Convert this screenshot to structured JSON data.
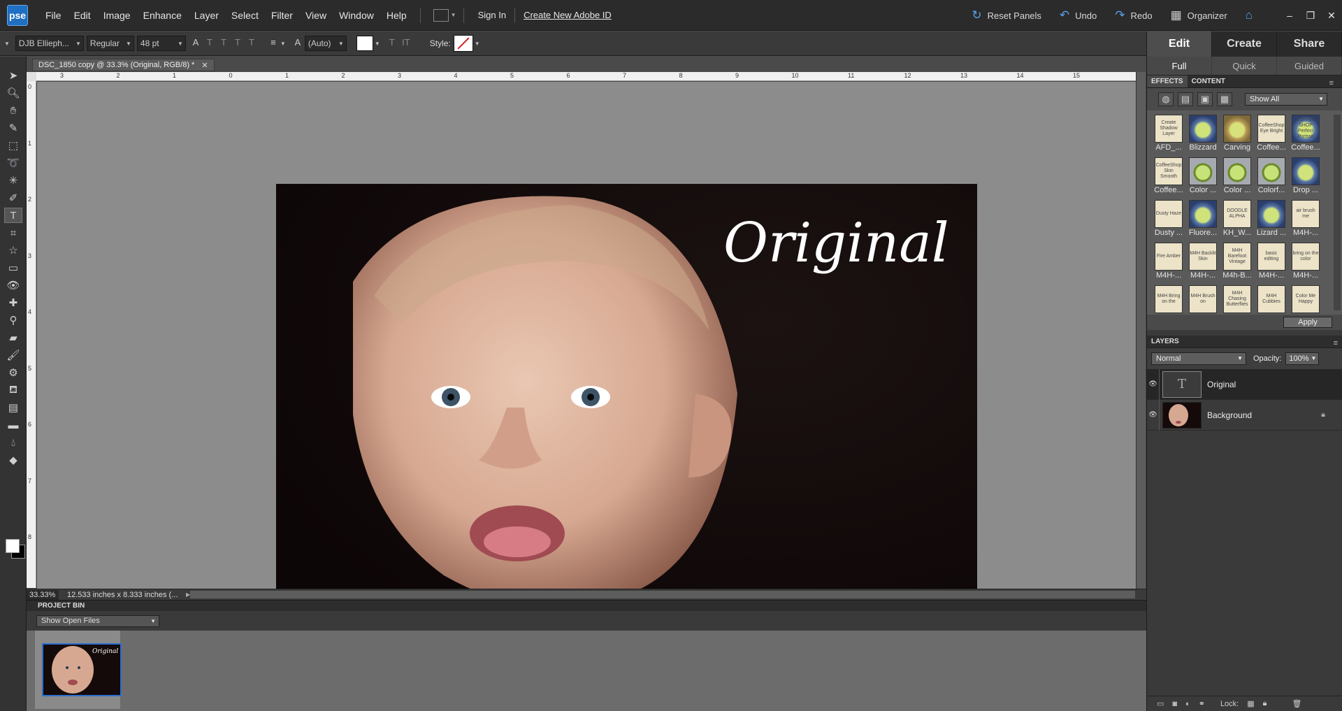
{
  "app": {
    "logo": "pse"
  },
  "menu": [
    "File",
    "Edit",
    "Image",
    "Enhance",
    "Layer",
    "Select",
    "Filter",
    "View",
    "Window",
    "Help"
  ],
  "account": {
    "sign_in": "Sign In",
    "create_id": "Create New Adobe ID"
  },
  "actions": {
    "reset_panels": "Reset Panels",
    "undo": "Undo",
    "redo": "Redo",
    "organizer": "Organizer"
  },
  "options": {
    "font_family": "DJB Ellieph...",
    "font_style": "Regular",
    "font_size": "48 pt",
    "leading": "(Auto)",
    "style_label": "Style:"
  },
  "document": {
    "tab_title": "DSC_1850 copy @ 33.3% (Original, RGB/8) *",
    "overlay_text": "Original",
    "zoom": "33.33%",
    "dimensions": "12.533 inches x 8.333 inches (..."
  },
  "ruler_h": [
    "3",
    "2",
    "1",
    "0",
    "1",
    "2",
    "3",
    "4",
    "5",
    "6",
    "7",
    "8",
    "9",
    "10",
    "11",
    "12",
    "13",
    "14",
    "15"
  ],
  "ruler_v": [
    "0",
    "1",
    "2",
    "3",
    "4",
    "5",
    "6",
    "7",
    "8"
  ],
  "project_bin": {
    "title": "PROJECT BIN",
    "filter": "Show Open Files"
  },
  "panel": {
    "main_tabs": [
      "Edit",
      "Create",
      "Share"
    ],
    "sub_tabs": [
      "Full",
      "Quick",
      "Guided"
    ],
    "effects_tabs": [
      "EFFECTS",
      "CONTENT"
    ],
    "show_filter": "Show All",
    "apply": "Apply",
    "effects": [
      [
        {
          "label": "AFD_...",
          "thumb": "Create Shadow Layer",
          "kind": "plain"
        },
        {
          "label": "Blizzard",
          "thumb": "",
          "kind": "blue"
        },
        {
          "label": "Carving",
          "thumb": "",
          "kind": "gold"
        },
        {
          "label": "Coffee...",
          "thumb": "CoffeeShop Eye Bright",
          "kind": "plain"
        },
        {
          "label": "Coffee...",
          "thumb": "COFFEE SHOP Perfect Portrait",
          "kind": "blue"
        }
      ],
      [
        {
          "label": "Coffee...",
          "thumb": "CoffeeShop Skin Smooth",
          "kind": "plain"
        },
        {
          "label": "Color ...",
          "thumb": "",
          "kind": "green"
        },
        {
          "label": "Color ...",
          "thumb": "",
          "kind": "green"
        },
        {
          "label": "Colorf...",
          "thumb": "",
          "kind": "green"
        },
        {
          "label": "Drop ...",
          "thumb": "",
          "kind": "blue"
        }
      ],
      [
        {
          "label": "Dusty ...",
          "thumb": "Dusty Haze",
          "kind": "plain"
        },
        {
          "label": "Fluore...",
          "thumb": "",
          "kind": "blue"
        },
        {
          "label": "KH_W...",
          "thumb": "DOODLE ALPHA",
          "kind": "plain"
        },
        {
          "label": "Lizard ...",
          "thumb": "",
          "kind": "blue"
        },
        {
          "label": "M4H-...",
          "thumb": "air brush me",
          "kind": "plain"
        }
      ],
      [
        {
          "label": "M4H-...",
          "thumb": "Fire Amber",
          "kind": "plain"
        },
        {
          "label": "M4H-...",
          "thumb": "M4H Backlit Skin",
          "kind": "plain"
        },
        {
          "label": "M4h-B...",
          "thumb": "M4H Barefoot Vintage",
          "kind": "plain"
        },
        {
          "label": "M4H-...",
          "thumb": "basic editing",
          "kind": "plain"
        },
        {
          "label": "M4H-...",
          "thumb": "bring on the color",
          "kind": "plain"
        }
      ],
      [
        {
          "label": "",
          "thumb": "M4H Bring on the",
          "kind": "plain"
        },
        {
          "label": "",
          "thumb": "M4H Brush on",
          "kind": "plain"
        },
        {
          "label": "",
          "thumb": "M4H Chasing Butterflies",
          "kind": "plain"
        },
        {
          "label": "",
          "thumb": "M4H Cubbies",
          "kind": "plain"
        },
        {
          "label": "",
          "thumb": "Color Me Happy",
          "kind": "plain"
        }
      ]
    ],
    "layers": {
      "title": "LAYERS",
      "blend": "Normal",
      "opacity_label": "Opacity:",
      "opacity": "100%",
      "items": [
        {
          "name": "Original",
          "type": "text",
          "thumb": "T"
        },
        {
          "name": "Background",
          "type": "image",
          "thumb": ""
        }
      ],
      "lock_label": "Lock:"
    }
  }
}
